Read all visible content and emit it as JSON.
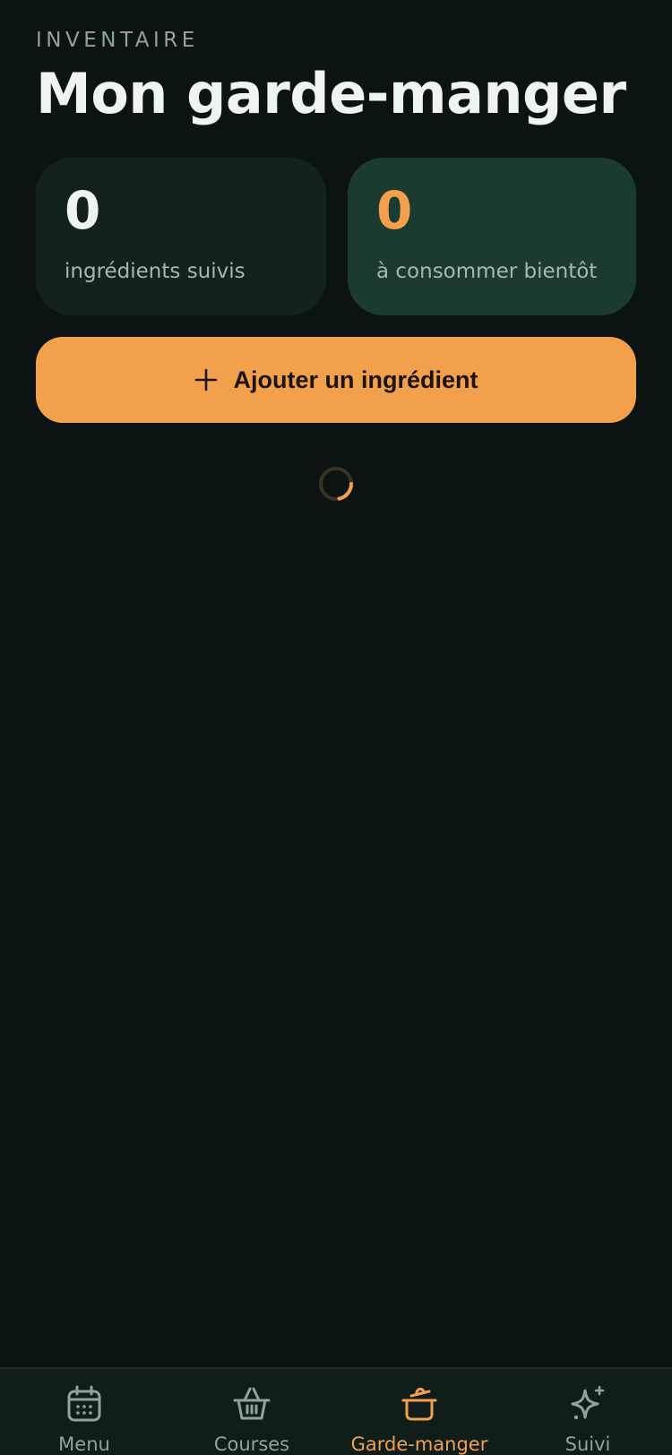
{
  "header": {
    "eyebrow": "INVENTAIRE",
    "title": "Mon garde-manger"
  },
  "stats": [
    {
      "value": "0",
      "label": "ingrédients suivis"
    },
    {
      "value": "0",
      "label": "à consommer bientôt"
    }
  ],
  "actions": {
    "add_label": "Ajouter un ingrédient",
    "add_icon": "plus-icon"
  },
  "loading": {
    "icon": "loading-spinner"
  },
  "nav": {
    "items": [
      {
        "label": "Menu",
        "icon": "calendar-icon",
        "active": false
      },
      {
        "label": "Courses",
        "icon": "basket-icon",
        "active": false
      },
      {
        "label": "Garde-manger",
        "icon": "pot-icon",
        "active": true
      },
      {
        "label": "Suivi",
        "icon": "sparkle-icon",
        "active": false
      }
    ]
  },
  "colors": {
    "background": "#0b1412",
    "accent": "#f2a04c",
    "card": "#14221e",
    "card_highlight": "#1b3b31",
    "muted_text": "#8fa49b"
  }
}
